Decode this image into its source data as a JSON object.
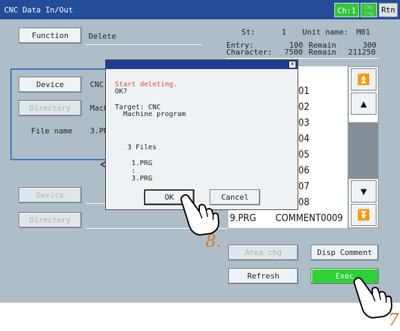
{
  "window": {
    "title": "CNC Data In/Out",
    "ch_label": "Ch:1",
    "cnc_chg_label": "CNC Chg",
    "rtn_label": "Rtn"
  },
  "function_row": {
    "button_label": "Function",
    "value": "Delete",
    "st_label": "St:",
    "st_value": "1",
    "unit_name_label": "Unit name:",
    "unit_name_value": "M01"
  },
  "stats": {
    "entry_label": "Entry:",
    "entry_value": "100",
    "entry_remain_label": "Remain",
    "entry_remain_value": "300",
    "character_label": "Character:",
    "character_value": "7500",
    "character_remain_label": "Remain",
    "character_remain_value": "211250"
  },
  "source": {
    "device_label": "Device",
    "device_value": "CNC",
    "directory_label": "Directory",
    "directory_value": "Mach",
    "file_name_label": "File name",
    "file_name_value": "3.PR"
  },
  "dest": {
    "device_label": "Device",
    "directory_label": "Directory"
  },
  "file_list": [
    {
      "name": "",
      "comment": "NT0001"
    },
    {
      "name": "",
      "comment": "NT0002"
    },
    {
      "name": "",
      "comment": "NT0003"
    },
    {
      "name": "",
      "comment": "NT0004"
    },
    {
      "name": "",
      "comment": "NT0005"
    },
    {
      "name": "",
      "comment": "NT0006"
    },
    {
      "name": "",
      "comment": "NT0007"
    },
    {
      "name": "",
      "comment": "NT0008"
    },
    {
      "name": "9.PRG",
      "comment": "COMMENT0009"
    }
  ],
  "buttons": {
    "area_chg": "Area chg",
    "disp_comment": "Disp Comment",
    "refresh": "Refresh",
    "exec": "Exec"
  },
  "dialog": {
    "message_line1": "Start deleting.",
    "message_line2": "OK?",
    "target_line1": "Target: CNC",
    "target_line2": "Machine program",
    "files_count": "3 Files",
    "file_first": "1.PRG",
    "file_ellipsis": ":",
    "file_last": "3.PRG",
    "ok_label": "OK",
    "cancel_label": "Cancel",
    "close_glyph": "✕"
  },
  "steps": {
    "step8": "8.",
    "step7": "7"
  },
  "colors": {
    "title_bar": "#244d99",
    "accent_green": "#2fcf38",
    "screen_bg": "#aebdc8",
    "step_orange": "#e4702a",
    "message_red": "#e0473a"
  }
}
